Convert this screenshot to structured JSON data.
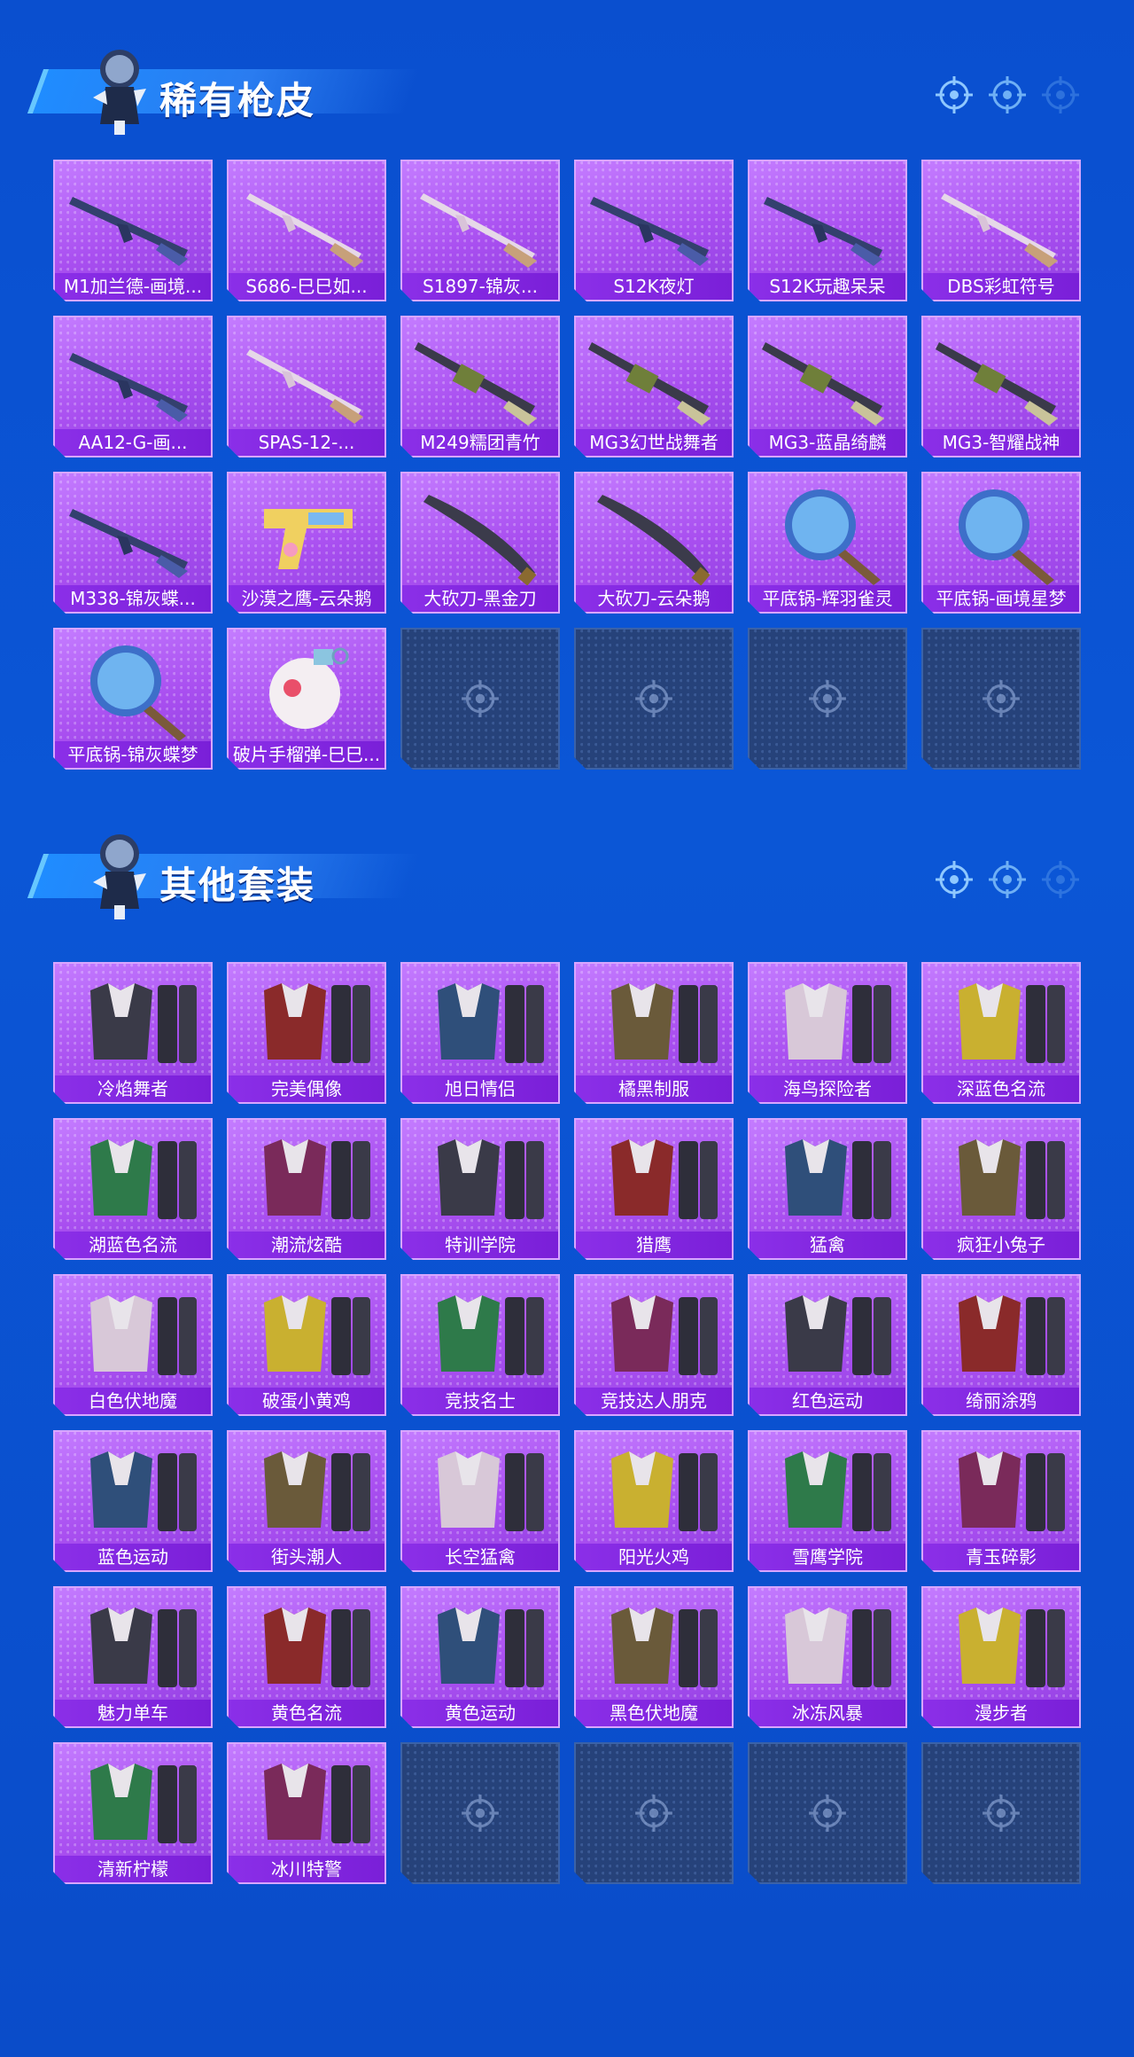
{
  "section1": {
    "title": "稀有枪皮",
    "items": [
      {
        "label": "M1加兰德-画境...",
        "icon": "rifle-icon"
      },
      {
        "label": "S686-巳巳如...",
        "icon": "shotgun-icon"
      },
      {
        "label": "S1897-锦灰...",
        "icon": "shotgun-icon"
      },
      {
        "label": "S12K夜灯",
        "icon": "rifle-icon"
      },
      {
        "label": "S12K玩趣呆呆",
        "icon": "rifle-icon"
      },
      {
        "label": "DBS彩虹符号",
        "icon": "shotgun-icon"
      },
      {
        "label": "AA12-G-画...",
        "icon": "rifle-icon"
      },
      {
        "label": "SPAS-12-...",
        "icon": "shotgun-icon"
      },
      {
        "label": "M249糯团青竹",
        "icon": "machinegun-icon"
      },
      {
        "label": "MG3幻世战舞者",
        "icon": "machinegun-icon"
      },
      {
        "label": "MG3-蓝晶绮麟",
        "icon": "machinegun-icon"
      },
      {
        "label": "MG3-智耀战神",
        "icon": "machinegun-icon"
      },
      {
        "label": "M338-锦灰蝶...",
        "icon": "rifle-icon"
      },
      {
        "label": "沙漠之鹰-云朵鹅",
        "icon": "pistol-icon"
      },
      {
        "label": "大砍刀-黑金刀",
        "icon": "machete-icon"
      },
      {
        "label": "大砍刀-云朵鹅",
        "icon": "machete-icon"
      },
      {
        "label": "平底锅-辉羽雀灵",
        "icon": "pan-icon"
      },
      {
        "label": "平底锅-画境星梦",
        "icon": "pan-icon"
      },
      {
        "label": "平底锅-锦灰蝶梦",
        "icon": "pan-icon"
      },
      {
        "label": "破片手榴弹-巳巳...",
        "icon": "grenade-icon"
      }
    ],
    "empty_slots": 4
  },
  "section2": {
    "title": "其他套装",
    "items": [
      {
        "label": "冷焰舞者",
        "icon": "outfit-icon"
      },
      {
        "label": "完美偶像",
        "icon": "outfit-icon"
      },
      {
        "label": "旭日情侣",
        "icon": "outfit-icon"
      },
      {
        "label": "橘黑制服",
        "icon": "outfit-icon"
      },
      {
        "label": "海鸟探险者",
        "icon": "outfit-icon"
      },
      {
        "label": "深蓝色名流",
        "icon": "outfit-icon"
      },
      {
        "label": "湖蓝色名流",
        "icon": "outfit-icon"
      },
      {
        "label": "潮流炫酷",
        "icon": "outfit-icon"
      },
      {
        "label": "特训学院",
        "icon": "outfit-icon"
      },
      {
        "label": "猎鹰",
        "icon": "outfit-icon"
      },
      {
        "label": "猛禽",
        "icon": "outfit-icon"
      },
      {
        "label": "疯狂小兔子",
        "icon": "outfit-icon"
      },
      {
        "label": "白色伏地魔",
        "icon": "outfit-icon"
      },
      {
        "label": "破蛋小黄鸡",
        "icon": "outfit-icon"
      },
      {
        "label": "竞技名士",
        "icon": "outfit-icon"
      },
      {
        "label": "竞技达人朋克",
        "icon": "outfit-icon"
      },
      {
        "label": "红色运动",
        "icon": "outfit-icon"
      },
      {
        "label": "绮丽涂鸦",
        "icon": "outfit-icon"
      },
      {
        "label": "蓝色运动",
        "icon": "outfit-icon"
      },
      {
        "label": "街头潮人",
        "icon": "outfit-icon"
      },
      {
        "label": "长空猛禽",
        "icon": "outfit-icon"
      },
      {
        "label": "阳光火鸡",
        "icon": "outfit-icon"
      },
      {
        "label": "雪鹰学院",
        "icon": "outfit-icon"
      },
      {
        "label": "青玉碎影",
        "icon": "outfit-icon"
      },
      {
        "label": "魅力单车",
        "icon": "outfit-icon"
      },
      {
        "label": "黄色名流",
        "icon": "outfit-icon"
      },
      {
        "label": "黄色运动",
        "icon": "outfit-icon"
      },
      {
        "label": "黑色伏地魔",
        "icon": "outfit-icon"
      },
      {
        "label": "冰冻风暴",
        "icon": "outfit-icon"
      },
      {
        "label": "漫步者",
        "icon": "outfit-icon"
      },
      {
        "label": "清新柠檬",
        "icon": "outfit-icon"
      },
      {
        "label": "冰川特警",
        "icon": "outfit-icon"
      }
    ],
    "empty_slots": 4
  },
  "colors": {
    "background": "#0a4fcf",
    "tile": "#a94ff0",
    "label_bar": "#8b2fe8",
    "empty_tile": "#26427a"
  }
}
